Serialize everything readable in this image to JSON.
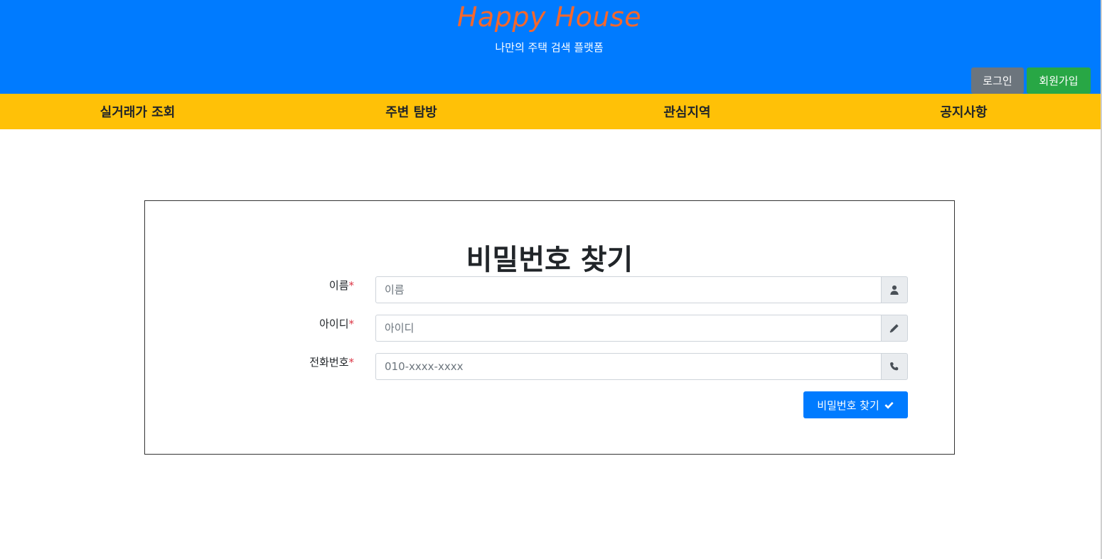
{
  "header": {
    "brand": "Happy House",
    "tagline": "나만의 주택 검색 플랫폼",
    "login_label": "로그인",
    "signup_label": "회원가입"
  },
  "nav": {
    "items": [
      {
        "label": "실거래가 조회"
      },
      {
        "label": "주변 탐방"
      },
      {
        "label": "관심지역"
      },
      {
        "label": "공지사항"
      }
    ]
  },
  "form": {
    "title": "비밀번호 찾기",
    "required_mark": "*",
    "fields": [
      {
        "label": "이름",
        "placeholder": "이름",
        "value": "",
        "icon": "user-icon"
      },
      {
        "label": "아이디",
        "placeholder": "아이디",
        "value": "",
        "icon": "pencil-icon"
      },
      {
        "label": "전화번호",
        "placeholder": "010-xxxx-xxxx",
        "value": "",
        "icon": "phone-icon"
      }
    ],
    "submit_label": "비밀번호 찾기",
    "submit_icon": "check-icon"
  },
  "colors": {
    "header_bg": "#007bff",
    "brand": "#f6672c",
    "nav_bg": "#ffc107",
    "login_bg": "#6c757d",
    "signup_bg": "#28a745",
    "submit_bg": "#007bff",
    "required": "#dc3545"
  }
}
